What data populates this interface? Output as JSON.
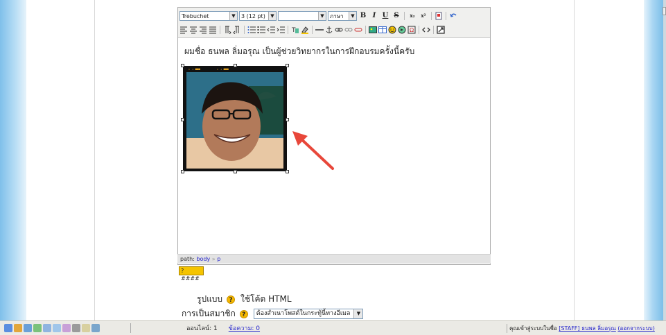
{
  "toolbar": {
    "font_family": "Trebuchet",
    "font_size": "3 (12 pt)",
    "format": "",
    "language": "ภาษา",
    "bold": "B",
    "italic": "I",
    "underline": "U",
    "strike": "S",
    "subscript": "x₂",
    "superscript": "x²"
  },
  "editor": {
    "text": "ผมชื่อ ธนพล ลิ่มอรุณ เป็นผู้ช่วยวิทยากรในการฝึกอบรมครั้งนี้ครับ"
  },
  "path": {
    "label": "path:",
    "body": "body",
    "sep": "»",
    "p": "p"
  },
  "help_button": "? ####",
  "form": {
    "format_label": "รูปแบบ",
    "format_value": "ใช้โค้ด HTML",
    "membership_label": "การเป็นสมาชิก",
    "membership_value": "ต้องสำเนาโพสต์ในกระทู้นี้ทางอีเมล"
  },
  "status": {
    "online": "ออนไลน์: 1",
    "messages": "ข้อความ: 0",
    "logged_in_prefix": "คุณเข้าสู่ระบบในชื่อ",
    "user_link": "[STAFF] ธนพล ลิ่มอรุณ",
    "logout": "(ออกจากระบบ)"
  },
  "colors": {
    "accent_arrow": "#e8473a",
    "link": "#2222cc",
    "help_yellow": "#f5c400"
  }
}
